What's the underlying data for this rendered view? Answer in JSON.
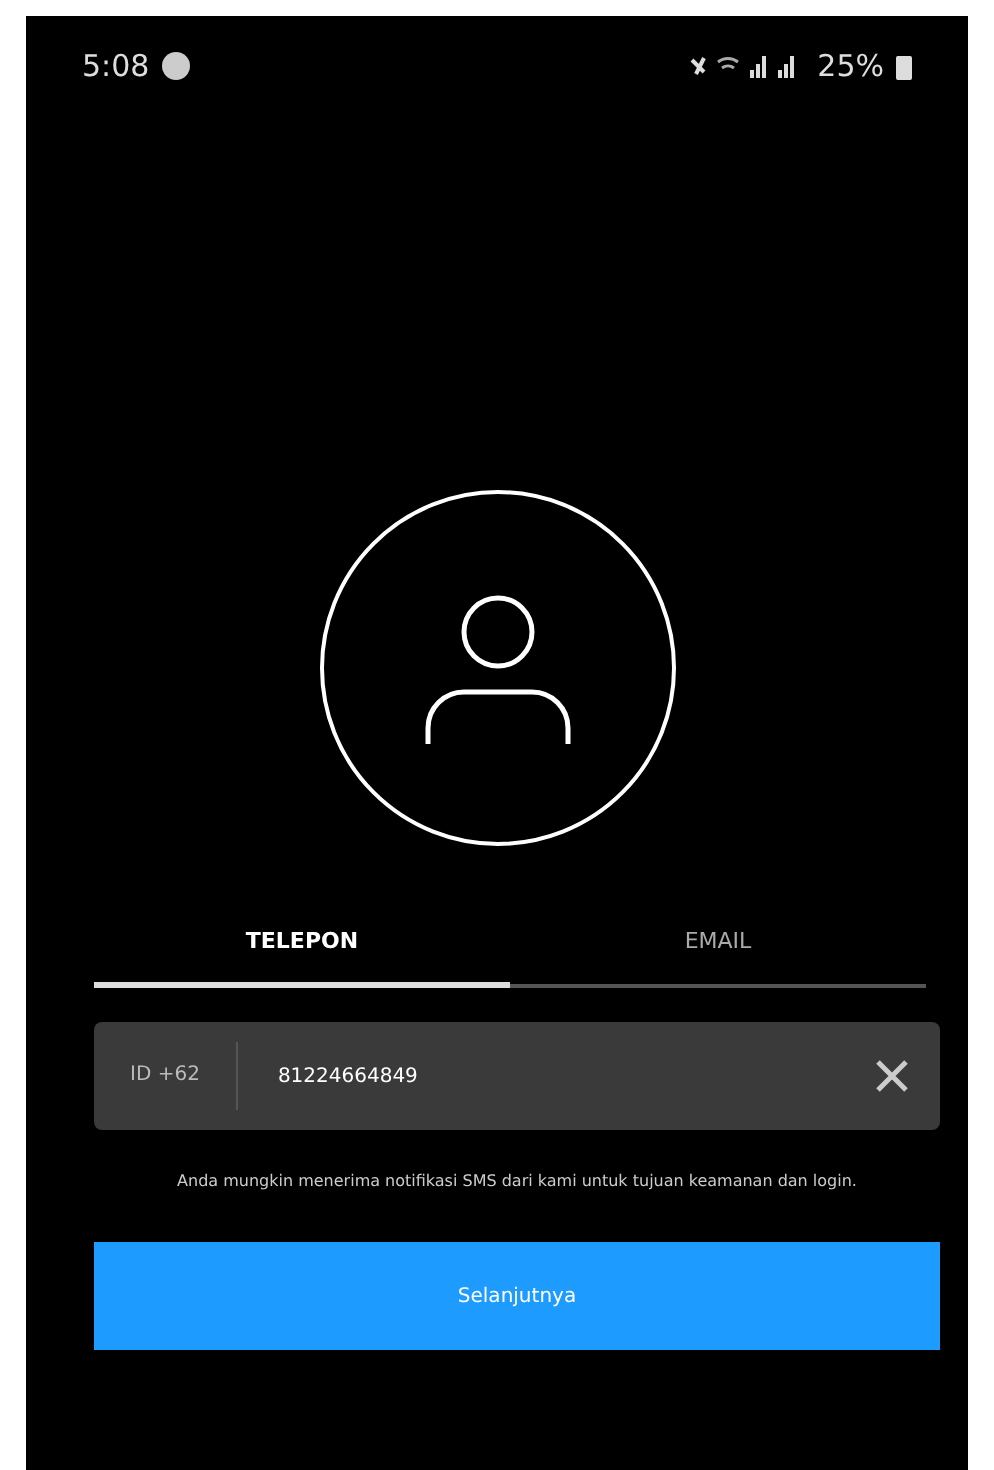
{
  "status_bar": {
    "time": "5:08",
    "battery": "25%"
  },
  "tabs": [
    {
      "label": "TELEPON",
      "selected": true
    },
    {
      "label": "EMAIL",
      "selected": false
    }
  ],
  "phone_field": {
    "country_code": "ID +62",
    "value": "81224664849"
  },
  "note": "Anda mungkin menerima notifikasi SMS dari kami untuk tujuan keamanan dan login.",
  "next_button": "Selanjutnya"
}
